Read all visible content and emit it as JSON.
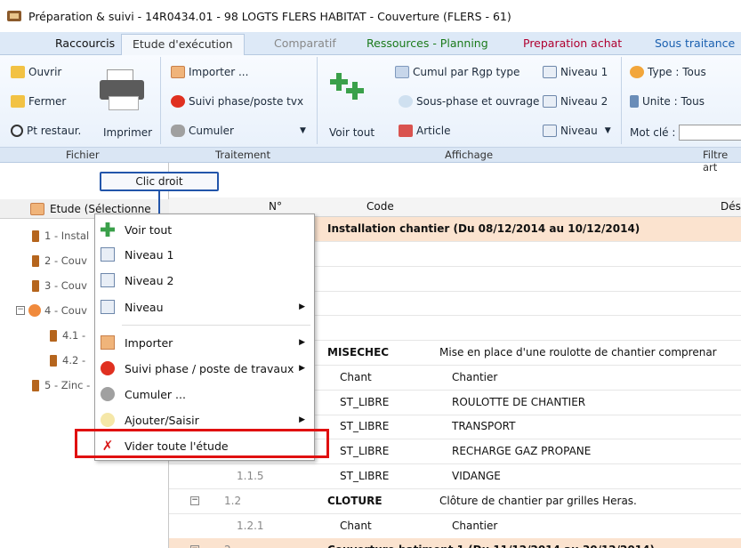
{
  "window": {
    "title": "Préparation & suivi - 14R0434.01 - 98 LOGTS FLERS HABITAT - Couverture (FLERS - 61)"
  },
  "tabs": [
    {
      "label": "Raccourcis"
    },
    {
      "label": "Etude d'exécution"
    },
    {
      "label": "Comparatif"
    },
    {
      "label": "Ressources - Planning"
    },
    {
      "label": "Preparation achat"
    },
    {
      "label": "Sous traitance"
    }
  ],
  "ribbon": {
    "fichier": {
      "ouvrir": "Ouvrir",
      "fermer": "Fermer",
      "pt_restaur": "Pt restaur.",
      "imprimer": "Imprimer",
      "label": "Fichier"
    },
    "traitement": {
      "importer": "Importer ...",
      "suivi": "Suivi phase/poste tvx",
      "cumuler": "Cumuler",
      "label": "Traitement"
    },
    "affichage": {
      "voir_tout": "Voir tout",
      "cumul": "Cumul par Rgp type",
      "sous_phase": "Sous-phase et ouvrage",
      "article": "Article",
      "niveau1": "Niveau 1",
      "niveau2": "Niveau 2",
      "niveau": "Niveau",
      "label": "Affichage"
    },
    "filtre": {
      "type": "Type : Tous",
      "unite": "Unite : Tous",
      "mot_cle": "Mot clé :",
      "label": "Filtre art"
    }
  },
  "callout": {
    "label": "Clic droit"
  },
  "tree": {
    "header": "Etude (Sélectionne",
    "items": [
      "1 - Instal",
      "2 - Couv",
      "3 - Couv",
      "4 - Couv",
      "4.1 -",
      "4.2 -",
      "5 - Zinc -"
    ]
  },
  "grid": {
    "headers": {
      "num": "N°",
      "code": "Code",
      "desig": "Dési"
    },
    "rows": [
      {
        "num": "",
        "code": "Installation chantier (Du 08/12/2014 au 10/12/2014)",
        "desig": "",
        "cat": true
      },
      {
        "num": "",
        "code": "",
        "desig": ""
      },
      {
        "num": "",
        "code": "",
        "desig": ""
      },
      {
        "num": "",
        "code": "",
        "desig": ""
      },
      {
        "num": "",
        "code": "",
        "desig": ""
      },
      {
        "num": "",
        "code": "MISECHEC",
        "desig": "Mise en place d'une roulotte de chantier comprenar"
      },
      {
        "num": "",
        "code": "Chant",
        "desig": "Chantier"
      },
      {
        "num": "",
        "code": "ST_LIBRE",
        "desig": "ROULOTTE DE CHANTIER"
      },
      {
        "num": "",
        "code": "ST_LIBRE",
        "desig": "TRANSPORT"
      },
      {
        "num": "",
        "code": "ST_LIBRE",
        "desig": "RECHARGE GAZ PROPANE"
      },
      {
        "num": "1.1.5",
        "code": "ST_LIBRE",
        "desig": "VIDANGE"
      },
      {
        "num": "1.2",
        "code": "CLOTURE",
        "desig": "Clôture de chantier par grilles Heras."
      },
      {
        "num": "1.2.1",
        "code": "Chant",
        "desig": "Chantier"
      },
      {
        "num": "2",
        "code": "Couverture batiment 1 (Du 11/12/2014 au 30/12/2014)",
        "desig": "",
        "cat": true
      }
    ]
  },
  "context_menu": {
    "items": [
      {
        "label": "Voir tout"
      },
      {
        "label": "Niveau 1"
      },
      {
        "label": "Niveau 2"
      },
      {
        "label": "Niveau"
      },
      {
        "label": "Importer"
      },
      {
        "label": "Suivi phase / poste de travaux"
      },
      {
        "label": "Cumuler ..."
      },
      {
        "label": "Ajouter/Saisir"
      },
      {
        "label": "Vider toute l'étude"
      }
    ]
  }
}
